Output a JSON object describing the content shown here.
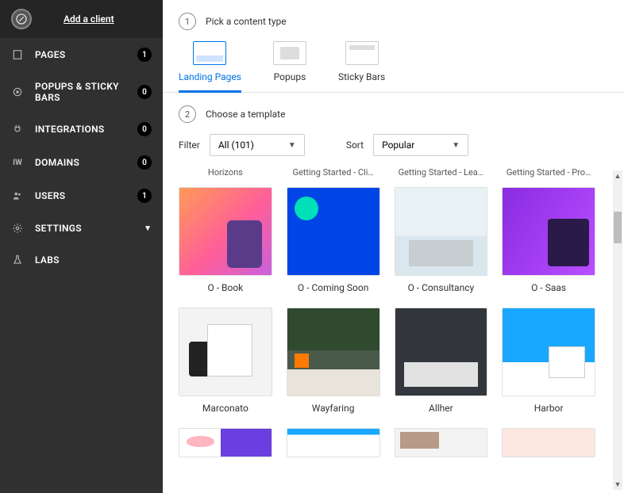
{
  "header": {
    "add_client": "Add a client"
  },
  "nav": [
    {
      "icon": "pages-icon",
      "label": "PAGES",
      "badge": "1"
    },
    {
      "icon": "target-icon",
      "label": "POPUPS & STICKY BARS",
      "badge": "0"
    },
    {
      "icon": "plug-icon",
      "label": "INTEGRATIONS",
      "badge": "0"
    },
    {
      "icon": "globe-icon",
      "label": "DOMAINS",
      "badge": "0"
    },
    {
      "icon": "users-icon",
      "label": "USERS",
      "badge": "1"
    },
    {
      "icon": "gear-icon",
      "label": "SETTINGS",
      "caret": true
    },
    {
      "icon": "flask-icon",
      "label": "LABS"
    }
  ],
  "step1": {
    "num": "1",
    "label": "Pick a content type"
  },
  "tabs": [
    {
      "label": "Landing Pages",
      "active": true
    },
    {
      "label": "Popups"
    },
    {
      "label": "Sticky Bars"
    }
  ],
  "step2": {
    "num": "2",
    "label": "Choose a template"
  },
  "filter": {
    "label": "Filter",
    "value": "All (101)"
  },
  "sort": {
    "label": "Sort",
    "value": "Popular"
  },
  "partial_row": [
    "Horizons",
    "Getting Started - Cli…",
    "Getting Started - Lea…",
    "Getting Started - Pro…"
  ],
  "templates_row1": [
    {
      "name": "O - Book",
      "cls": "t-book"
    },
    {
      "name": "O - Coming Soon",
      "cls": "t-coming"
    },
    {
      "name": "O - Consultancy",
      "cls": "t-consult"
    },
    {
      "name": "O - Saas",
      "cls": "t-saas"
    }
  ],
  "templates_row2": [
    {
      "name": "Marconato",
      "cls": "t-marc"
    },
    {
      "name": "Wayfaring",
      "cls": "t-way"
    },
    {
      "name": "Allher",
      "cls": "t-all"
    },
    {
      "name": "Harbor",
      "cls": "t-harbor"
    }
  ],
  "templates_row3": [
    {
      "name": "",
      "cls": "t-p1"
    },
    {
      "name": "",
      "cls": "t-p2"
    },
    {
      "name": "",
      "cls": "t-p3"
    },
    {
      "name": "",
      "cls": "t-p4"
    }
  ]
}
